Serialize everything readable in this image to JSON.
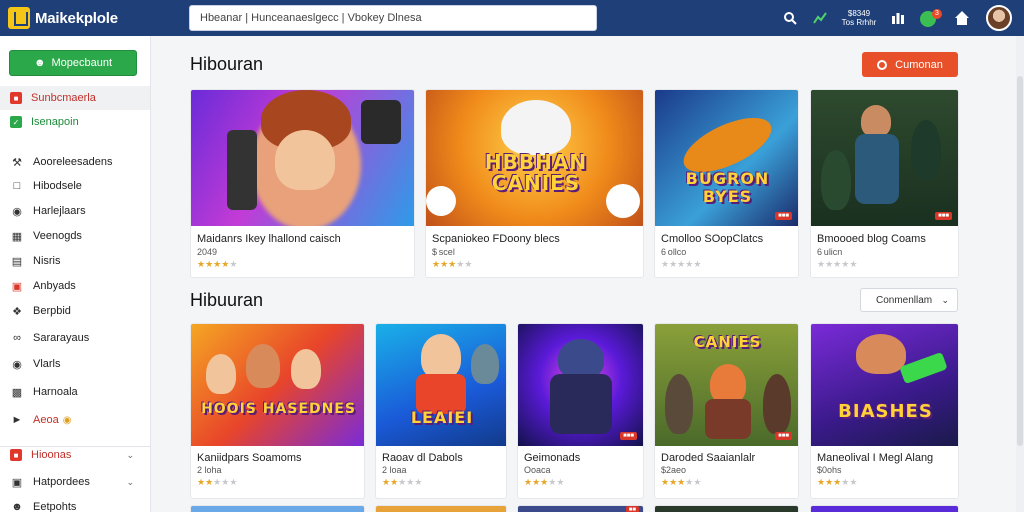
{
  "app": {
    "logo_text": "Maikekplole"
  },
  "search": {
    "value": "Hbeanar | Hunceanaeslgecc | Vbokey Dlnesa"
  },
  "header": {
    "price_mini_line1": "$8349",
    "price_mini_line2": "Tos Rrhhr",
    "notif_count": "3"
  },
  "sidebar": {
    "primary_button": "Mopecbaunt",
    "items": [
      {
        "label": "Sunbcmaerla",
        "icon": "tag-icon"
      },
      {
        "label": "Isenapoin",
        "icon": "check-square-icon"
      },
      {
        "label": "Aooreleesadens",
        "icon": "hammer-icon"
      },
      {
        "label": "Hibodsele",
        "icon": "square-icon"
      },
      {
        "label": "Harlejlaars",
        "icon": "chat-icon"
      },
      {
        "label": "Veenogds",
        "icon": "calendar-icon"
      },
      {
        "label": "Nisris",
        "icon": "book-icon"
      },
      {
        "label": "Anbyads",
        "icon": "gamepad-icon"
      },
      {
        "label": "Berpbid",
        "icon": "puzzle-icon"
      },
      {
        "label": "Sararayaus",
        "icon": "link-icon"
      },
      {
        "label": "Vlarls",
        "icon": "circle-icon"
      },
      {
        "label": "Harnoala",
        "icon": "building-icon"
      },
      {
        "label": "Aeoa",
        "icon": "tag-outline-icon"
      },
      {
        "label": "Hioonas",
        "icon": "folder-icon"
      },
      {
        "label": "Hatpordees",
        "icon": "car-icon"
      },
      {
        "label": "Eetpohts",
        "icon": "person-icon"
      }
    ]
  },
  "section1": {
    "title": "Hibouran",
    "cta": "Cumonan",
    "cards": [
      {
        "title": "Maidanrs Ikey lhallond caisch",
        "price": "2049",
        "rating": 4,
        "banner": ""
      },
      {
        "title": "Scpaniokeo FDoony blecs",
        "price": "$ scel",
        "rating": 3,
        "banner": "HBBHAN CANIES"
      },
      {
        "title": "Cmolloo SOopClatcs",
        "price": "6 ollco",
        "rating": 0,
        "banner": "BUGRON BYES"
      },
      {
        "title": "Bmoooed blog Coams",
        "price": "6 ulicn",
        "rating": 0,
        "banner": ""
      }
    ]
  },
  "section2": {
    "title": "Hibuuran",
    "sort": "Conmenllam",
    "cards": [
      {
        "title": "Kaniidpars Soamoms",
        "price": "2 loha",
        "rating": 2,
        "banner": "HOOIS HASEDNES"
      },
      {
        "title": "Raoav dl Dabols",
        "price": "2 loaa",
        "rating": 2,
        "banner": "LEAIEI"
      },
      {
        "title": "Geimonads",
        "price": "Ooaca",
        "rating": 3,
        "banner": ""
      },
      {
        "title": "Daroded Saaianlalr",
        "price": "$2aeo",
        "rating": 3,
        "banner": "CANIES"
      },
      {
        "title": "Maneolival I Megl Alang",
        "price": "$0ohs",
        "rating": 3,
        "banner": "BIASHES"
      }
    ]
  }
}
